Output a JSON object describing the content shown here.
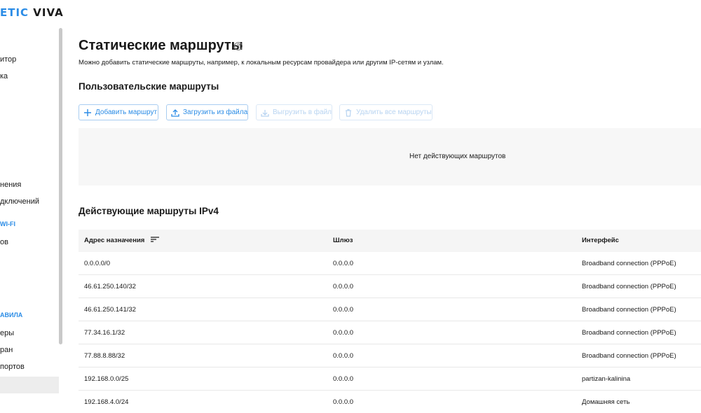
{
  "brand": {
    "logo_accent": "ETIC",
    "logo_rest": " VIVA",
    "accent_color": "#2b8ce6"
  },
  "sidebar": {
    "items": [
      {
        "label": "итор"
      },
      {
        "label": "ка"
      },
      {
        "label": "нения"
      },
      {
        "label": "дключений"
      },
      {
        "label": "ов"
      },
      {
        "label": "еры"
      },
      {
        "label": "ран"
      },
      {
        "label": "портов"
      }
    ],
    "sections": [
      {
        "label": "WI-FI"
      },
      {
        "label": "АВИЛА"
      }
    ]
  },
  "page": {
    "title": "Статические маршруты",
    "description": "Можно добавить статические маршруты, например, к локальным ресурсам провайдера или другим IP-сетям и узлам."
  },
  "user_routes": {
    "title": "Пользовательские маршруты",
    "buttons": {
      "add": "Добавить маршрут",
      "upload": "Загрузить из файла",
      "download": "Выгрузить в файл",
      "delete_all": "Удалить все маршруты"
    },
    "empty_text": "Нет действующих маршрутов"
  },
  "ipv4_routes": {
    "title": "Действующие маршруты IPv4",
    "columns": [
      "Адрес назначения",
      "Шлюз",
      "Интерфейс"
    ],
    "rows": [
      [
        "0.0.0.0/0",
        "0.0.0.0",
        "Broadband connection (PPPoE)"
      ],
      [
        "46.61.250.140/32",
        "0.0.0.0",
        "Broadband connection (PPPoE)"
      ],
      [
        "46.61.250.141/32",
        "0.0.0.0",
        "Broadband connection (PPPoE)"
      ],
      [
        "77.34.16.1/32",
        "0.0.0.0",
        "Broadband connection (PPPoE)"
      ],
      [
        "77.88.8.88/32",
        "0.0.0.0",
        "Broadband connection (PPPoE)"
      ],
      [
        "192.168.0.0/25",
        "0.0.0.0",
        "partizan-kalinina"
      ],
      [
        "192.168.4.0/24",
        "0.0.0.0",
        "Домашняя сеть"
      ]
    ]
  }
}
